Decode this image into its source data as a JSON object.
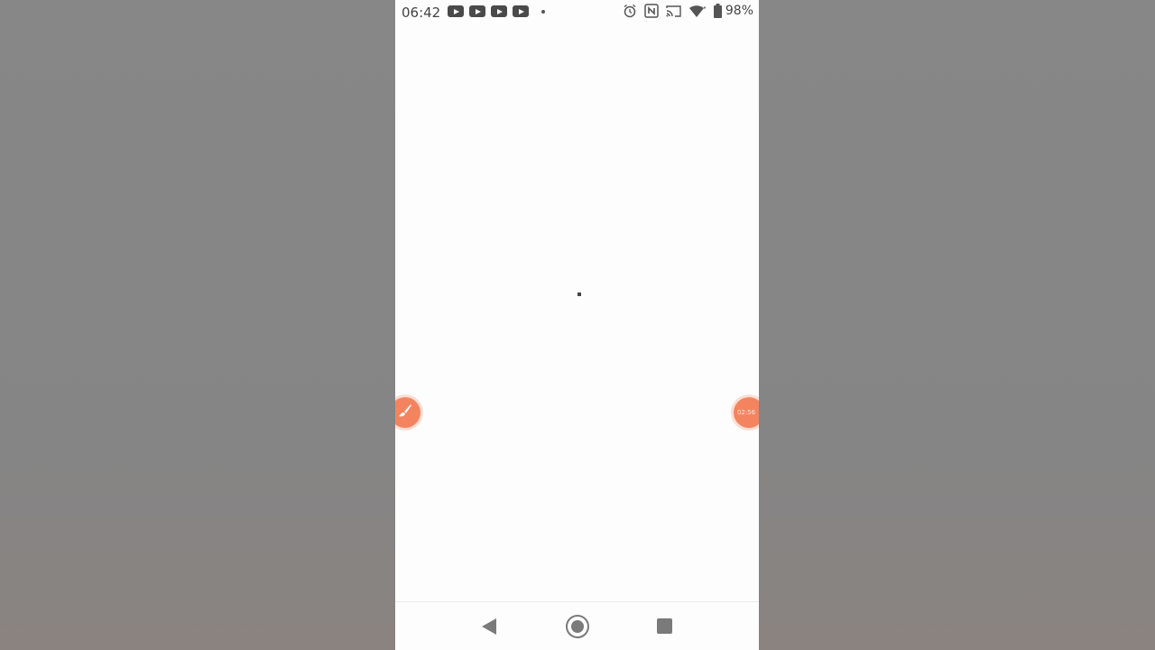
{
  "status_bar": {
    "time": "06:42",
    "notification_icons": [
      "youtube-icon",
      "youtube-icon",
      "youtube-icon",
      "youtube-icon",
      "more-dot-icon"
    ],
    "system_icons": [
      "alarm-icon",
      "nfc-icon",
      "cast-icon",
      "wifi-icon",
      "battery-icon"
    ],
    "battery_percent": "98%"
  },
  "content": {
    "state": "loading"
  },
  "floating_buttons": {
    "left_icon": "paintbrush-icon",
    "right_timer": "02:56",
    "accent_color": "#f4845f"
  },
  "nav_bar": {
    "buttons": [
      "back",
      "home",
      "recents"
    ]
  }
}
